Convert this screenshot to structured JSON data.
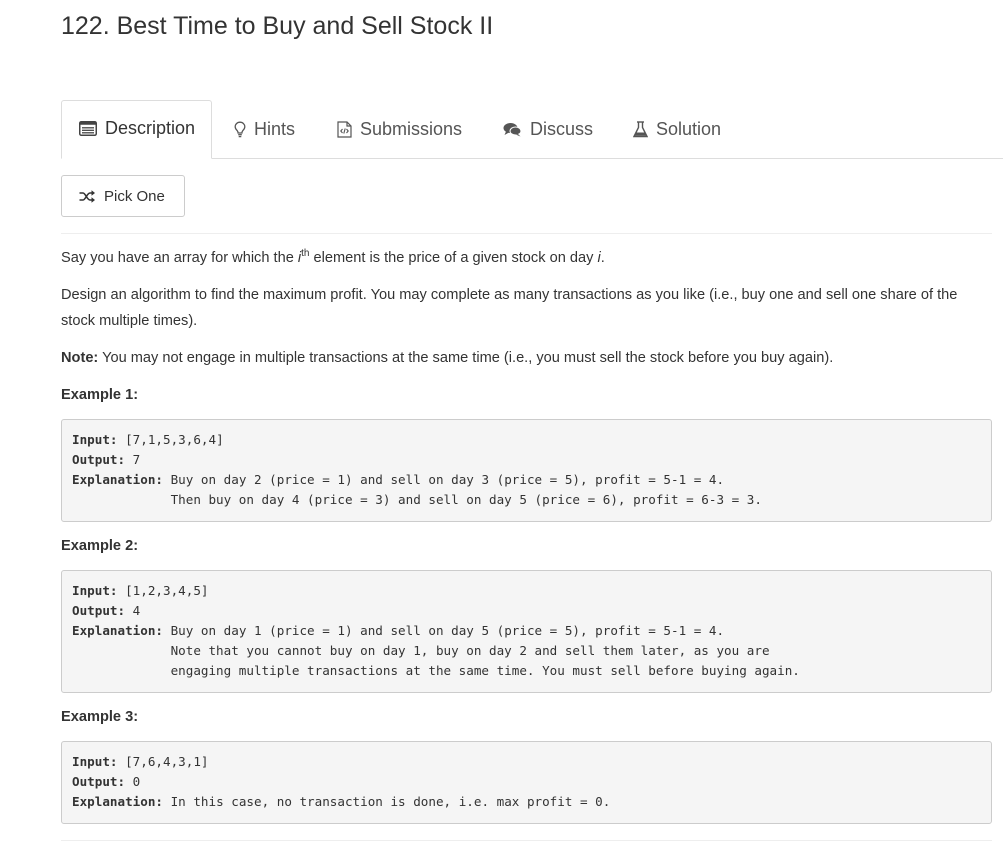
{
  "problem": {
    "title": "122. Best Time to Buy and Sell Stock II"
  },
  "tabs": [
    {
      "label": "Description",
      "icon": "list-icon",
      "active": true
    },
    {
      "label": "Hints",
      "icon": "lightbulb-icon",
      "active": false
    },
    {
      "label": "Submissions",
      "icon": "code-file-icon",
      "active": false
    },
    {
      "label": "Discuss",
      "icon": "comments-icon",
      "active": false
    },
    {
      "label": "Solution",
      "icon": "flask-icon",
      "active": false
    }
  ],
  "pick_one": {
    "label": "Pick One",
    "icon": "shuffle-icon"
  },
  "description": {
    "p1_before": "Say you have an array for which the ",
    "p1_var": "i",
    "p1_sup": "th",
    "p1_after": " element is the price of a given stock on day ",
    "p1_day": "i",
    "p1_end": ".",
    "p2": "Design an algorithm to find the maximum profit. You may complete as many transactions as you like (i.e., buy one and sell one share of the stock multiple times).",
    "note_label": "Note:",
    "note_text": " You may not engage in multiple transactions at the same time (i.e., you must sell the stock before you buy again)."
  },
  "examples": [
    {
      "heading": "Example 1:",
      "input_label": "Input:",
      "input": " [7,1,5,3,6,4]",
      "output_label": "Output:",
      "output": " 7",
      "explanation_label": "Explanation:",
      "explanation_lines": [
        " Buy on day 2 (price = 1) and sell on day 3 (price = 5), profit = 5-1 = 4.",
        "             Then buy on day 4 (price = 3) and sell on day 5 (price = 6), profit = 6-3 = 3."
      ]
    },
    {
      "heading": "Example 2:",
      "input_label": "Input:",
      "input": " [1,2,3,4,5]",
      "output_label": "Output:",
      "output": " 4",
      "explanation_label": "Explanation:",
      "explanation_lines": [
        " Buy on day 1 (price = 1) and sell on day 5 (price = 5), profit = 5-1 = 4.",
        "             Note that you cannot buy on day 1, buy on day 2 and sell them later, as you are",
        "             engaging multiple transactions at the same time. You must sell before buying again."
      ]
    },
    {
      "heading": "Example 3:",
      "input_label": "Input:",
      "input": " [7,6,4,3,1]",
      "output_label": "Output:",
      "output": " 0",
      "explanation_label": "Explanation:",
      "explanation_lines": [
        " In this case, no transaction is done, i.e. max profit = 0."
      ]
    }
  ]
}
